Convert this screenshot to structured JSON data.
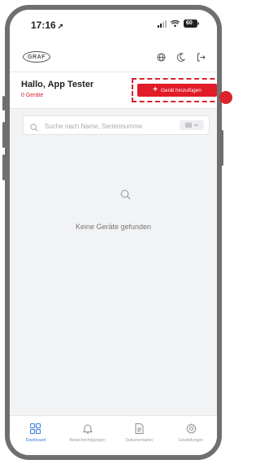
{
  "status_bar": {
    "time": "17:16",
    "battery": "60"
  },
  "header": {
    "logo_text": "GRAF",
    "icons": [
      "globe-icon",
      "moon-icon",
      "logout-icon"
    ]
  },
  "greeting": {
    "title": "Hallo, App Tester",
    "device_count": "0 Geräte",
    "add_button_label": "Gerät hinzufügen"
  },
  "search": {
    "placeholder": "Suche nach Name, Seriennumme",
    "value": ""
  },
  "empty_state": {
    "icon": "search-icon",
    "text": "Keine Geräte gefunden"
  },
  "bottom_nav": {
    "items": [
      {
        "label": "Dashboard",
        "icon": "grid-icon",
        "active": true
      },
      {
        "label": "Benachrichtigungen",
        "icon": "bell-icon",
        "active": false
      },
      {
        "label": "Dokumentation",
        "icon": "document-icon",
        "active": false
      },
      {
        "label": "Einstellungen",
        "icon": "settings-icon",
        "active": false
      }
    ]
  },
  "colors": {
    "accent_red": "#e21b28",
    "active_blue": "#3b7ddd",
    "frame": "#6f6f6f"
  }
}
